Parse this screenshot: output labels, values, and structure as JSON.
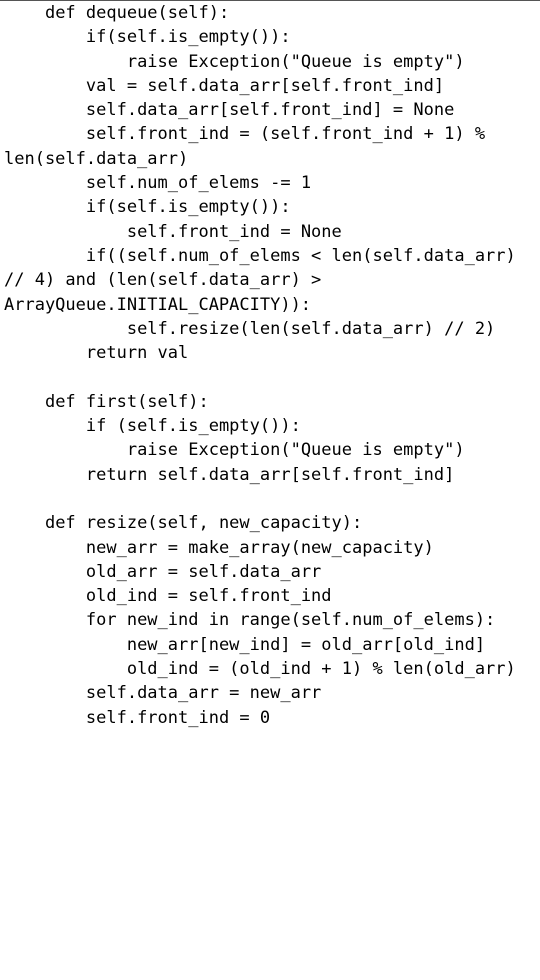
{
  "code": {
    "lines": [
      "    def dequeue(self):",
      "        if(self.is_empty()):",
      "            raise Exception(\"Queue is empty\")",
      "        val = self.data_arr[self.front_ind]",
      "        self.data_arr[self.front_ind] = None",
      "        self.front_ind = (self.front_ind + 1) % len(self.data_arr)",
      "        self.num_of_elems -= 1",
      "        if(self.is_empty()):",
      "            self.front_ind = None",
      "        if((self.num_of_elems < len(self.data_arr) // 4) and (len(self.data_arr) > ArrayQueue.INITIAL_CAPACITY)):",
      "            self.resize(len(self.data_arr) // 2)",
      "        return val",
      "",
      "    def first(self):",
      "        if (self.is_empty()):",
      "            raise Exception(\"Queue is empty\")",
      "        return self.data_arr[self.front_ind]",
      "",
      "    def resize(self, new_capacity):",
      "        new_arr = make_array(new_capacity)",
      "        old_arr = self.data_arr",
      "        old_ind = self.front_ind",
      "        for new_ind in range(self.num_of_elems):",
      "            new_arr[new_ind] = old_arr[old_ind]",
      "            old_ind = (old_ind + 1) % len(old_arr)",
      "        self.data_arr = new_arr",
      "        self.front_ind = 0"
    ]
  }
}
